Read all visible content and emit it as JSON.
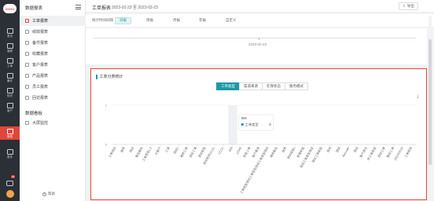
{
  "rail": {
    "logo_text": "ZOHO",
    "items": [
      {
        "label": "首页",
        "icon": "home-icon"
      },
      {
        "label": "客服",
        "icon": "headset-icon"
      },
      {
        "label": "工单",
        "icon": "ticket-icon"
      },
      {
        "label": "备件",
        "icon": "box-icon"
      },
      {
        "label": "知识",
        "icon": "book-icon"
      },
      {
        "label": "客户",
        "icon": "customer-icon"
      },
      {
        "label": "报表",
        "icon": "report-icon"
      },
      {
        "label": "更多",
        "icon": "more-icon"
      }
    ],
    "message_badge": "20"
  },
  "sidebar": {
    "title": "数据报表",
    "items": [
      {
        "label": "工单报表"
      },
      {
        "label": "绩效报表"
      },
      {
        "label": "备件报表"
      },
      {
        "label": "收藏报表"
      },
      {
        "label": "客户报表"
      },
      {
        "label": "产品报表"
      },
      {
        "label": "员工报表"
      },
      {
        "label": "回访报表"
      }
    ],
    "section_title": "数据看板",
    "section_items": [
      {
        "label": "大屏监控"
      }
    ],
    "help": "帮助"
  },
  "header": {
    "title": "工单报表",
    "date_range": "2023-02-23 至 2023-02-23",
    "export": "导出"
  },
  "filter": {
    "label": "统计时间间隔",
    "options": [
      "日报",
      "周报",
      "月报",
      "年报",
      "自定义"
    ]
  },
  "top_chart": {
    "x_label": "2023-02-23"
  },
  "chart": {
    "title": "工单分类统计",
    "tabs": [
      "工单类型",
      "渠道来源",
      "在保状态",
      "服务模式"
    ],
    "tooltip": {
      "title": "999",
      "series": "工单类型",
      "value": "0"
    },
    "accent": "#1a9aa5",
    "highlight": "#e0463a"
  },
  "chart_data": {
    "type": "bar",
    "ylim": [
      0,
      1
    ],
    "yticks": [
      "1",
      "0"
    ],
    "series": [
      {
        "name": "工单类型"
      }
    ],
    "categories": [
      "工单测试",
      "维修",
      "测试",
      "售后服务",
      "工单类型1.2",
      "大客户",
      "工单",
      "测试1",
      "维修工单",
      "测试工单",
      "测试类型",
      "测试类别12121",
      "12121",
      "999",
      "12345",
      "安装工单",
      "客户需求",
      "工单类型测试工单类型测试工单类型测试",
      "维修售后",
      "保养",
      "测试类型1",
      "新增类型",
      "测试工单类型测试",
      "测试工单类型",
      "测试",
      "测试",
      "Barcode",
      "测试",
      "客户拜访",
      "修工单类型",
      "测试工单",
      "售后工单",
      "2023/02/23",
      "工单类别"
    ],
    "values": [
      0,
      0,
      0,
      0,
      0,
      0,
      0,
      0,
      0,
      0,
      0,
      0,
      0,
      0,
      0,
      0,
      0,
      0,
      0,
      0,
      0,
      0,
      0,
      0,
      0,
      0,
      0,
      0,
      0,
      0,
      0,
      0,
      0,
      0
    ],
    "highlight_index": 13
  }
}
